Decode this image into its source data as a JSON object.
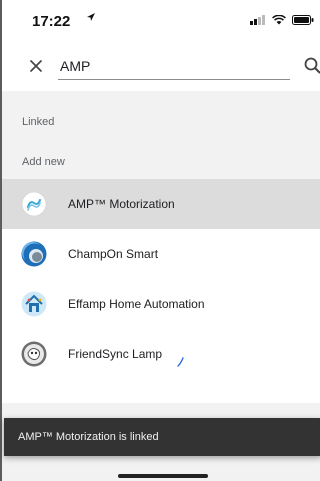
{
  "status_bar": {
    "time": "17:22"
  },
  "search": {
    "query": "AMP"
  },
  "sections": {
    "linked": "Linked",
    "add_new": "Add new"
  },
  "results": [
    {
      "label": "AMP™ Motorization",
      "icon": "amp-motorization-logo",
      "selected": true
    },
    {
      "label": "ChampOn Smart",
      "icon": "champon-smart-logo",
      "selected": false
    },
    {
      "label": "Effamp Home Automation",
      "icon": "effamp-house-logo",
      "selected": false
    },
    {
      "label": "FriendSync Lamp",
      "icon": "friendsync-lamp-logo",
      "selected": false
    }
  ],
  "snackbar": {
    "message": "AMP™ Motorization is linked"
  },
  "colors": {
    "selected_row": "#dcdcdc",
    "snackbar_bg": "#333333",
    "background": "#f2f2f2"
  }
}
